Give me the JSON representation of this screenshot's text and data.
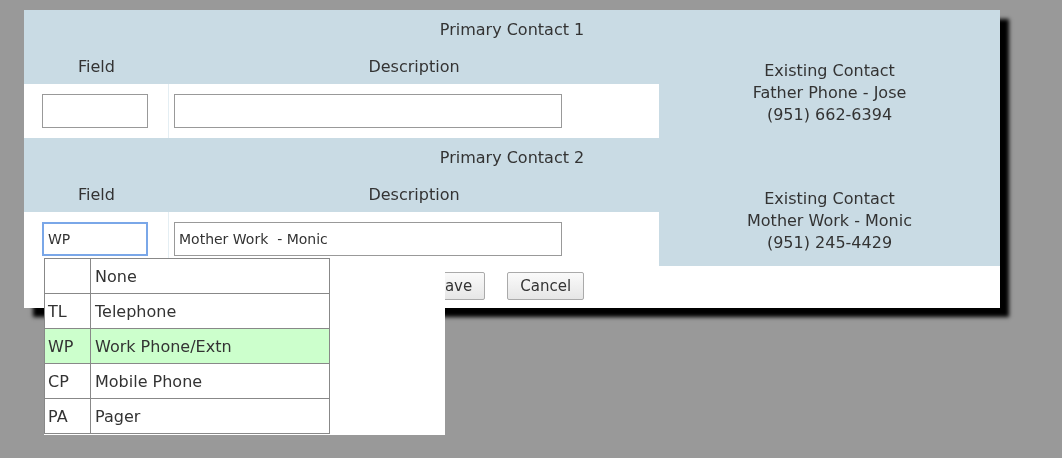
{
  "sections": [
    {
      "title": "Primary Contact 1",
      "columns": [
        "Field",
        "Description"
      ],
      "field": {
        "focused": false
      },
      "existing": {
        "heading": "Existing Contact",
        "name": "Father Phone - Jose",
        "phone": "(951) 662-6394"
      }
    },
    {
      "title": "Primary Contact 2",
      "columns": [
        "Field",
        "Description"
      ],
      "field": {
        "value": "WP",
        "focused": true
      },
      "description": {
        "value": "Mother Work  - Monic"
      },
      "existing": {
        "heading": "Existing Contact",
        "name": "Mother Work - Monic",
        "phone": "(951) 245-4429"
      }
    }
  ],
  "buttons": [
    "ave",
    "Cancel"
  ],
  "dropdown": {
    "options": [
      {
        "label": "None",
        "selected": false
      },
      {
        "code": "TL",
        "label": "Telephone",
        "selected": false
      },
      {
        "code": "WP",
        "label": "Work Phone/Extn",
        "selected": true
      },
      {
        "code": "CP",
        "label": "Mobile Phone",
        "selected": false
      },
      {
        "code": "PA",
        "label": "Pager",
        "selected": false
      }
    ]
  }
}
